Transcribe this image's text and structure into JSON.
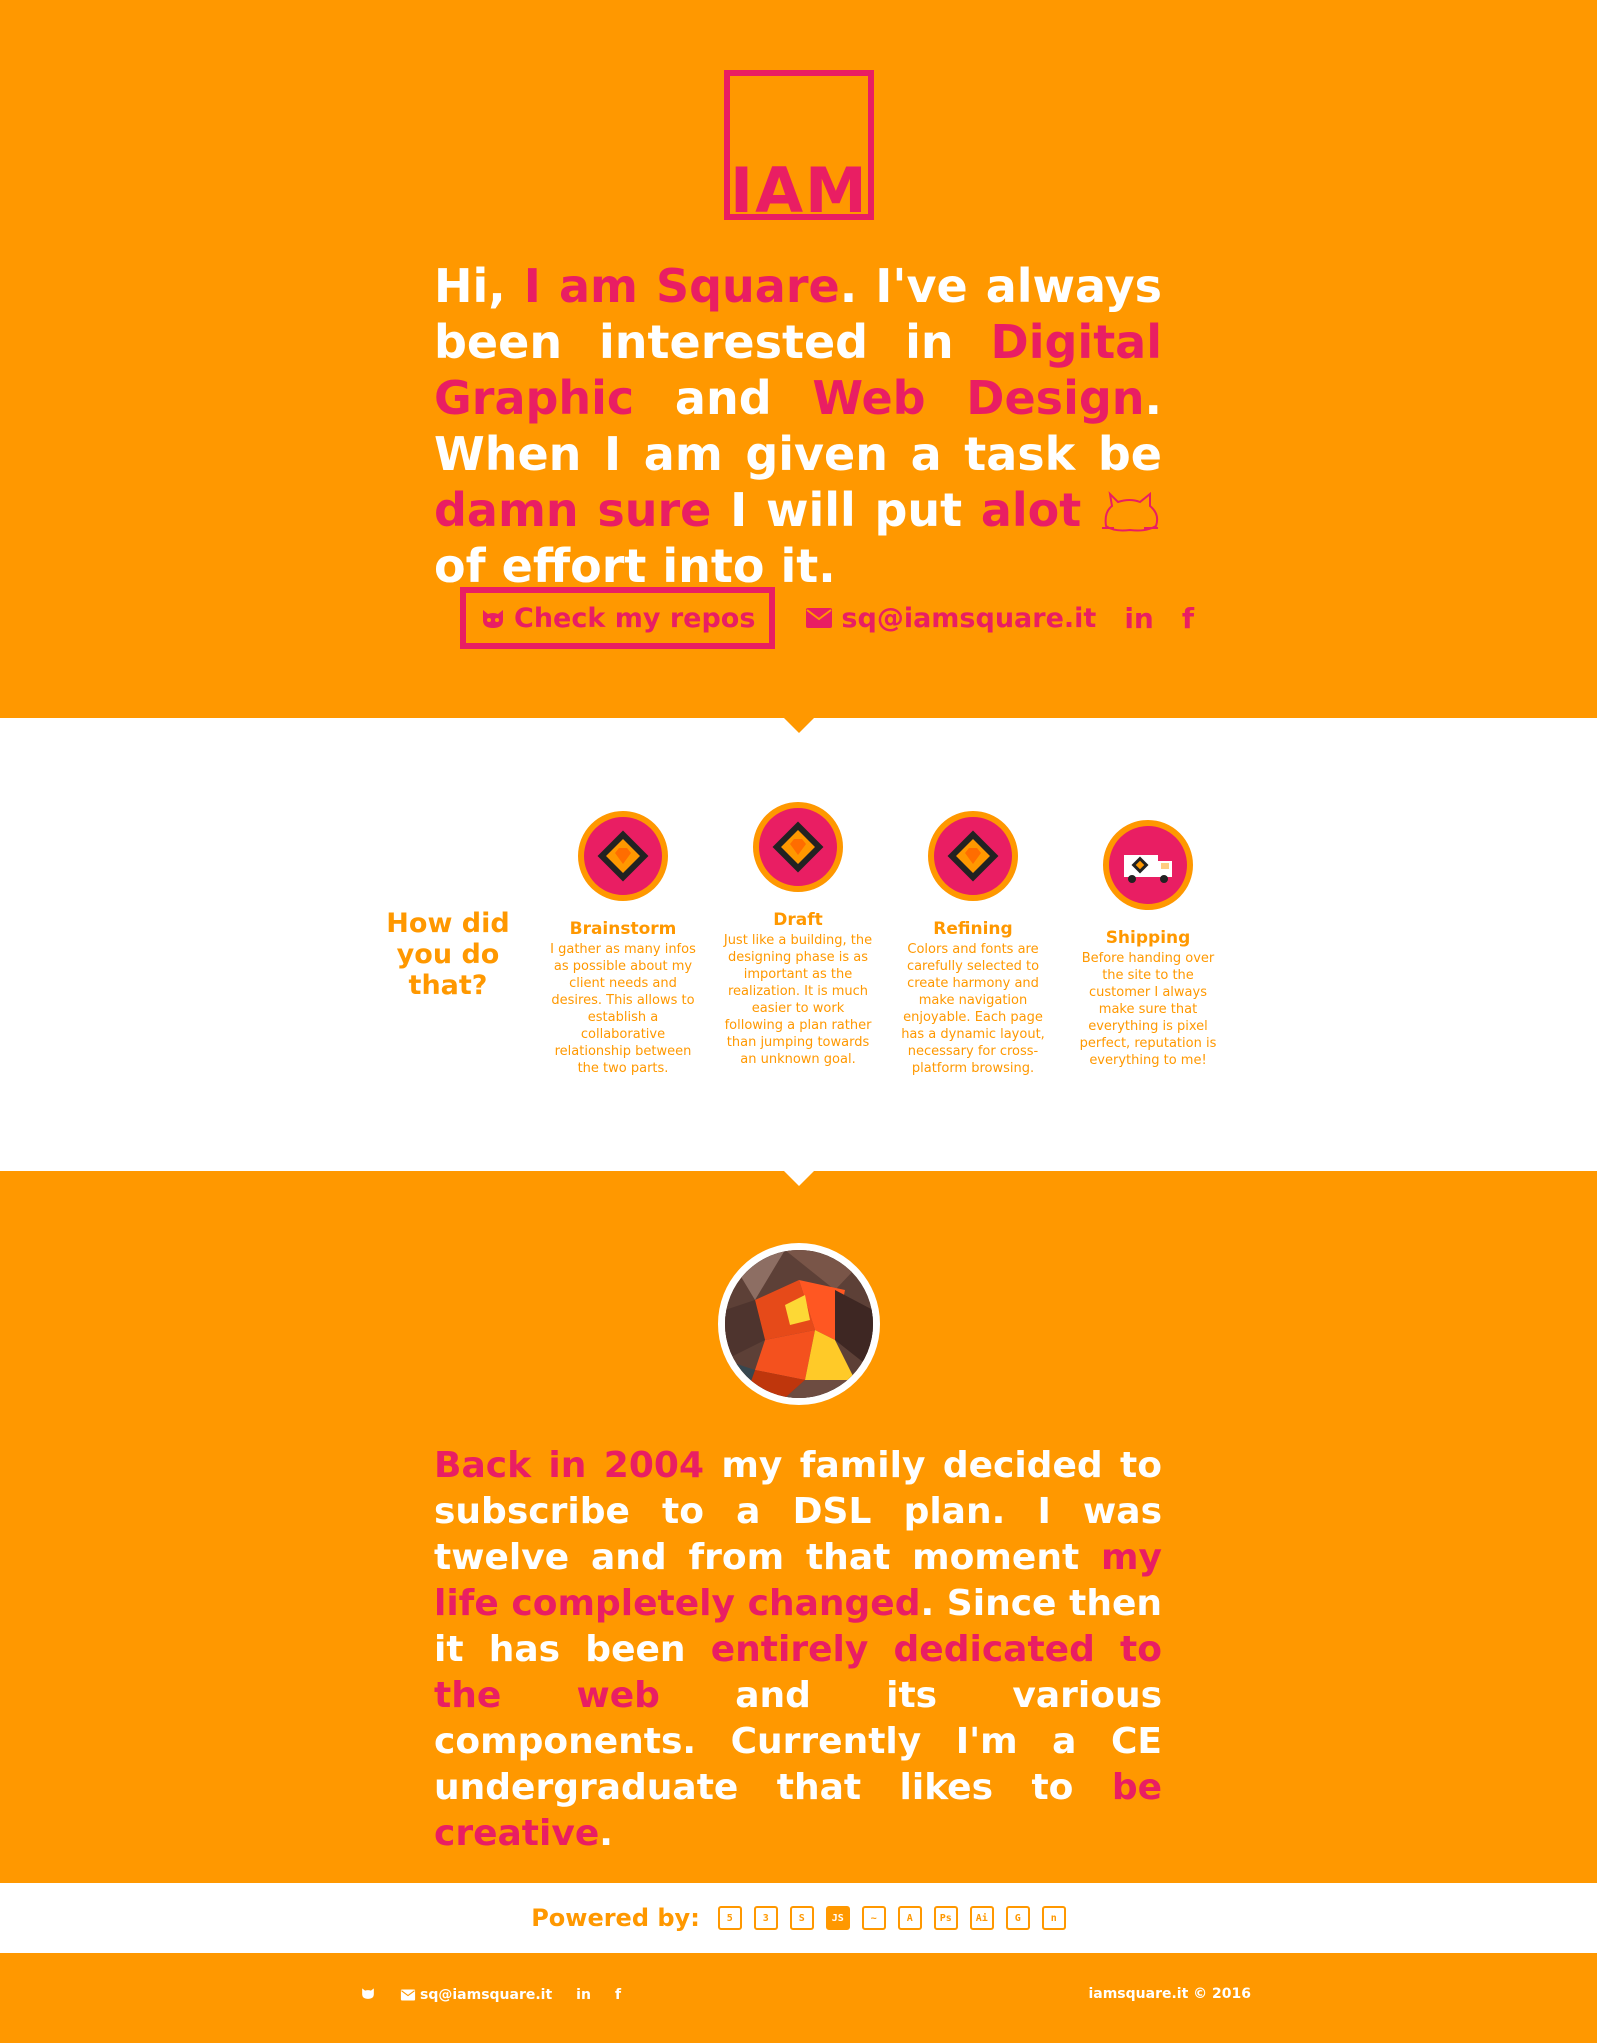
{
  "colors": {
    "orange": "#ff9800",
    "pink": "#e91e63",
    "white": "#ffffff"
  },
  "logo": {
    "text": "IAM"
  },
  "intro": {
    "parts": [
      {
        "text": "Hi, ",
        "hl": false
      },
      {
        "text": "I am Square",
        "hl": true
      },
      {
        "text": ". I've always been interested in ",
        "hl": false
      },
      {
        "text": "Digital Graphic",
        "hl": true
      },
      {
        "text": " and ",
        "hl": false
      },
      {
        "text": "Web Design",
        "hl": true
      },
      {
        "text": ". When I am given a task be ",
        "hl": false
      },
      {
        "text": "damn sure",
        "hl": true
      },
      {
        "text": " I will put ",
        "hl": false
      },
      {
        "text": "alot",
        "hl": true
      },
      {
        "text": " of effort into it.",
        "hl": false
      }
    ]
  },
  "links": {
    "repos_label": "Check my repos",
    "email": "sq@iamsquare.it",
    "linkedin_icon": "in",
    "facebook_icon": "f"
  },
  "process": {
    "heading": "How did you do that?",
    "steps": [
      {
        "title": "Brainstorm",
        "desc": "I gather as many infos as possible about my client needs and desires. This allows to establish a collaborative relationship between the two parts.",
        "icon": "gem-icon"
      },
      {
        "title": "Draft",
        "desc": "Just like a building, the designing phase is as important as the realization. It is much easier to work following a plan rather than jumping towards an unknown goal.",
        "icon": "gem-icon"
      },
      {
        "title": "Refining",
        "desc": "Colors and fonts are carefully selected to create harmony and make navigation enjoyable. Each page has a dynamic layout, necessary for cross-platform browsing.",
        "icon": "gem-icon"
      },
      {
        "title": "Shipping",
        "desc": "Before handing over the site to the customer I always make sure that everything is pixel perfect, reputation is everything to me!",
        "icon": "truck-icon"
      }
    ]
  },
  "about": {
    "parts": [
      {
        "text": "Back in 2004",
        "hl": true
      },
      {
        "text": " my family decided to subscribe to a DSL plan. I was twelve and from that moment ",
        "hl": false
      },
      {
        "text": "my life completely changed",
        "hl": true
      },
      {
        "text": ". Since then it has been ",
        "hl": false
      },
      {
        "text": "entirely dedicated to the web",
        "hl": true
      },
      {
        "text": " and its various components. Currently I'm a CE undergraduate that likes to ",
        "hl": false
      },
      {
        "text": "be creative",
        "hl": true
      },
      {
        "text": ".",
        "hl": false
      }
    ]
  },
  "powered": {
    "label": "Powered by:",
    "techs": [
      {
        "name": "html5-icon",
        "glyph": "5",
        "solid": false
      },
      {
        "name": "css3-icon",
        "glyph": "3",
        "solid": false
      },
      {
        "name": "sass-icon",
        "glyph": "S",
        "solid": false
      },
      {
        "name": "javascript-icon",
        "glyph": "JS",
        "solid": true
      },
      {
        "name": "jquery-icon",
        "glyph": "~",
        "solid": false
      },
      {
        "name": "angular-icon",
        "glyph": "A",
        "solid": false
      },
      {
        "name": "photoshop-icon",
        "glyph": "Ps",
        "solid": false
      },
      {
        "name": "illustrator-icon",
        "glyph": "Ai",
        "solid": false
      },
      {
        "name": "gulp-icon",
        "glyph": "G",
        "solid": false
      },
      {
        "name": "npm-icon",
        "glyph": "n",
        "solid": false
      }
    ]
  },
  "footer": {
    "email": "sq@iamsquare.it",
    "linkedin_icon": "in",
    "facebook_icon": "f",
    "copyright": "iamsquare.it © 2016"
  }
}
